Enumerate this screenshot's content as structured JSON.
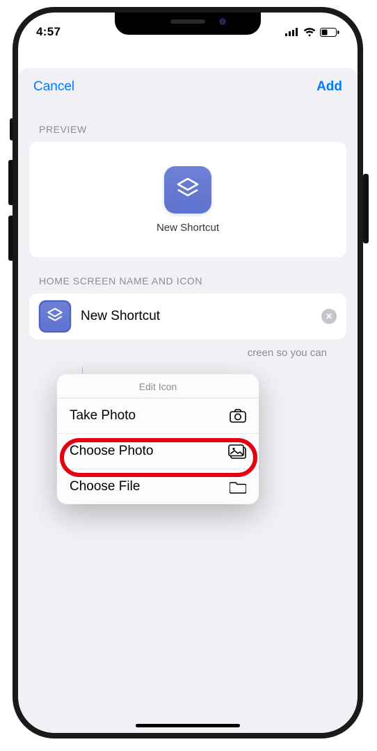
{
  "statusbar": {
    "time": "4:57"
  },
  "nav": {
    "cancel": "Cancel",
    "add": "Add"
  },
  "preview": {
    "header": "PREVIEW",
    "label": "New Shortcut"
  },
  "home_section": {
    "header": "HOME SCREEN NAME AND ICON",
    "shortcut_name": "New Shortcut",
    "hint_visible": "creen so you can"
  },
  "popover": {
    "title": "Edit Icon",
    "items": [
      {
        "label": "Take Photo",
        "icon": "camera-icon"
      },
      {
        "label": "Choose Photo",
        "icon": "photo-library-icon"
      },
      {
        "label": "Choose File",
        "icon": "folder-icon"
      }
    ]
  }
}
